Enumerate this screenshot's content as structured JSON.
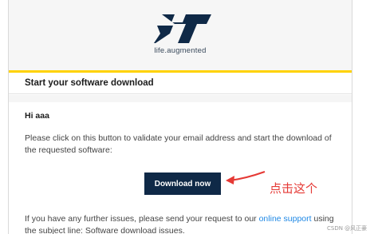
{
  "header": {
    "logo_icon": "st-logo-icon",
    "tagline": "life.augmented",
    "accent_color": "#ffd200",
    "brand_color": "#0f2947"
  },
  "section": {
    "title": "Start your software download"
  },
  "body": {
    "greeting": "Hi aaa",
    "instructions": "Please click on this button to validate your email address and start the download of the requested software:",
    "download_button_label": "Download now",
    "support_prefix": "If you have any further issues, please send your request to our ",
    "support_link": "online support",
    "support_suffix": " using the subject line: Software download issues."
  },
  "annotation": {
    "text": "点击这个",
    "color": "#e53935",
    "arrow_icon": "red-arrow-icon"
  },
  "watermark": "CSDN @风正豪"
}
